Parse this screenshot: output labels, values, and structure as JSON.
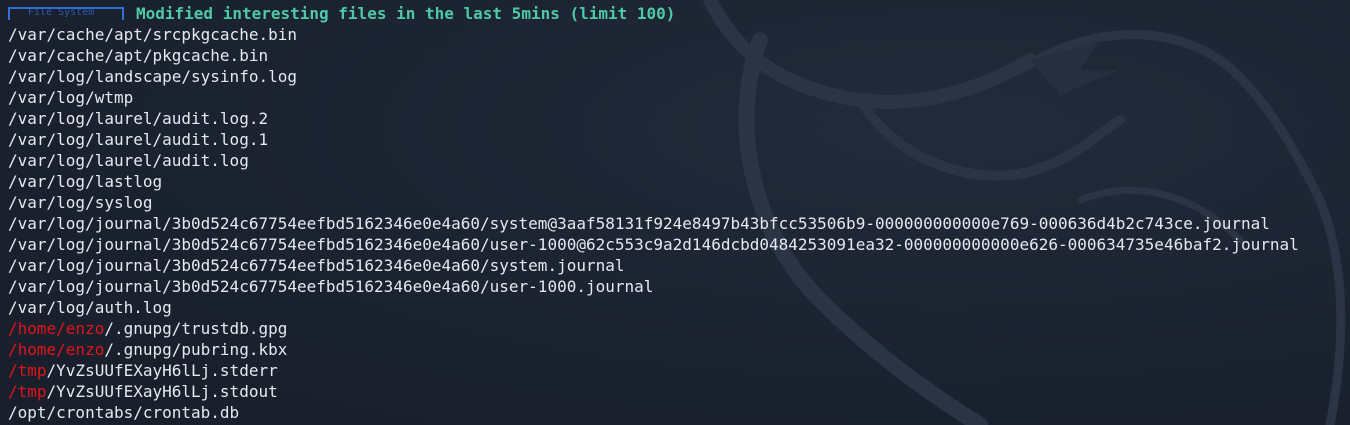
{
  "terminal": {
    "section_tag": "File System",
    "header_title": "Modified interesting files in the last 5mins (limit 100)",
    "lines": [
      {
        "highlight": "",
        "rest": "/var/cache/apt/srcpkgcache.bin"
      },
      {
        "highlight": "",
        "rest": "/var/cache/apt/pkgcache.bin"
      },
      {
        "highlight": "",
        "rest": "/var/log/landscape/sysinfo.log"
      },
      {
        "highlight": "",
        "rest": "/var/log/wtmp"
      },
      {
        "highlight": "",
        "rest": "/var/log/laurel/audit.log.2"
      },
      {
        "highlight": "",
        "rest": "/var/log/laurel/audit.log.1"
      },
      {
        "highlight": "",
        "rest": "/var/log/laurel/audit.log"
      },
      {
        "highlight": "",
        "rest": "/var/log/lastlog"
      },
      {
        "highlight": "",
        "rest": "/var/log/syslog"
      },
      {
        "highlight": "",
        "rest": "/var/log/journal/3b0d524c67754eefbd5162346e0e4a60/system@3aaf58131f924e8497b43bfcc53506b9-000000000000e769-000636d4b2c743ce.journal"
      },
      {
        "highlight": "",
        "rest": "/var/log/journal/3b0d524c67754eefbd5162346e0e4a60/user-1000@62c553c9a2d146dcbd0484253091ea32-000000000000e626-000634735e46baf2.journal"
      },
      {
        "highlight": "",
        "rest": "/var/log/journal/3b0d524c67754eefbd5162346e0e4a60/system.journal"
      },
      {
        "highlight": "",
        "rest": "/var/log/journal/3b0d524c67754eefbd5162346e0e4a60/user-1000.journal"
      },
      {
        "highlight": "",
        "rest": "/var/log/auth.log"
      },
      {
        "highlight": "/home/enzo",
        "rest": "/.gnupg/trustdb.gpg"
      },
      {
        "highlight": "/home/enzo",
        "rest": "/.gnupg/pubring.kbx"
      },
      {
        "highlight": "/tmp",
        "rest": "/YvZsUUfEXayH6lLj.stderr"
      },
      {
        "highlight": "/tmp",
        "rest": "/YvZsUUfEXayH6lLj.stdout"
      },
      {
        "highlight": "",
        "rest": "/opt/crontabs/crontab.db"
      }
    ]
  },
  "colors": {
    "background": "#1c2330",
    "text": "#e6e9ee",
    "header": "#4ec9a5",
    "highlight": "#e0141b",
    "section_box": "#2f6fd6"
  },
  "icons": {
    "watermark": "kali-dragon-icon"
  }
}
